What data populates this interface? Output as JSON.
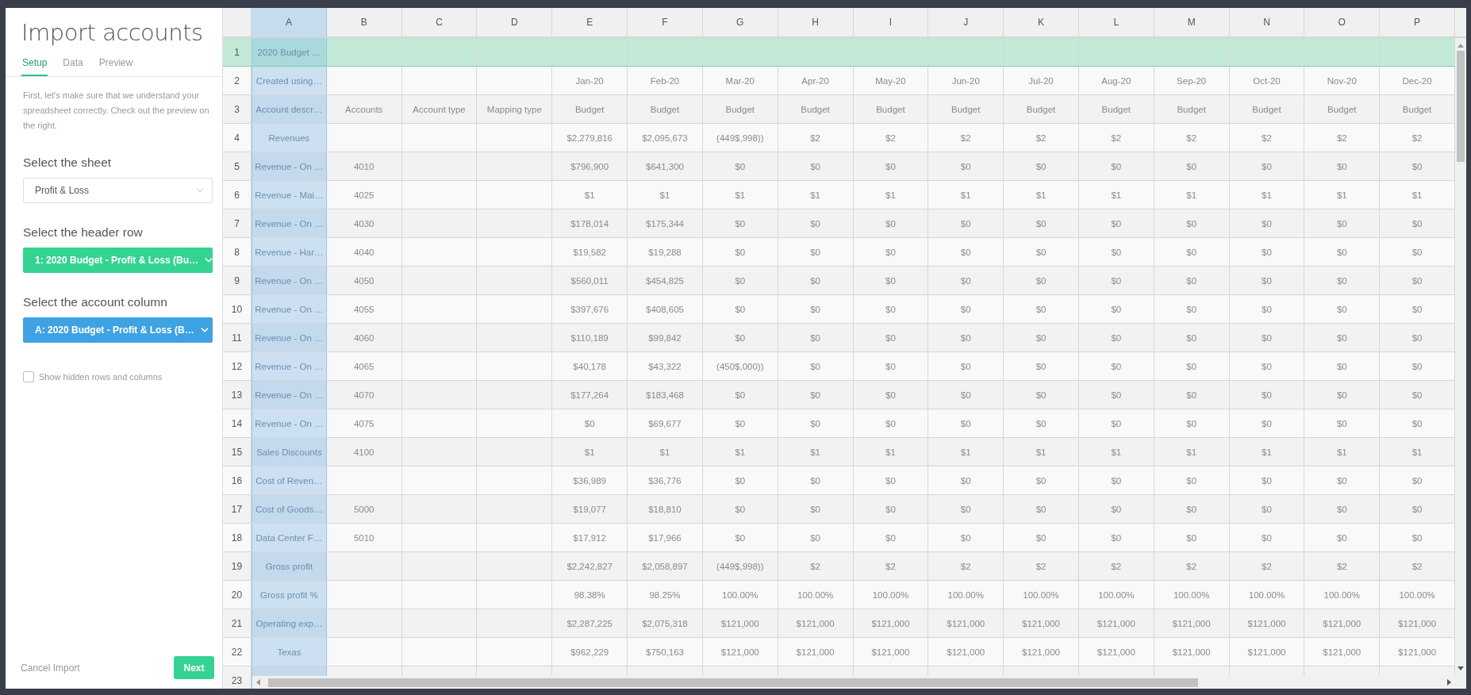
{
  "panel": {
    "title": "Import accounts",
    "tabs": [
      {
        "label": "Setup",
        "selected": true
      },
      {
        "label": "Data",
        "selected": false
      },
      {
        "label": "Preview",
        "selected": false
      }
    ],
    "intro": "First, let's make sure that we understand your spreadsheet correctly. Check out the preview on the right.",
    "selects": [
      {
        "label": "Select the sheet",
        "value": "Profit & Loss",
        "kind": "plain"
      },
      {
        "label": "Select the header row",
        "value": "1: 2020 Budget - Profit & Loss (Bu…",
        "kind": "header"
      },
      {
        "label": "Select the account column",
        "value": "A: 2020 Budget - Profit & Loss (B…",
        "kind": "column"
      }
    ],
    "checkbox": {
      "label": "Show hidden rows and columns",
      "checked": false
    },
    "cancel": "Cancel Import",
    "next": "Next"
  },
  "sheet": {
    "columns": [
      {
        "label": "A",
        "selected": true
      },
      {
        "label": "B",
        "selected": false
      },
      {
        "label": "C",
        "selected": false
      },
      {
        "label": "D",
        "selected": false
      },
      {
        "label": "E",
        "selected": false
      },
      {
        "label": "F",
        "selected": false
      },
      {
        "label": "G",
        "selected": false
      },
      {
        "label": "H",
        "selected": false
      },
      {
        "label": "I",
        "selected": false
      },
      {
        "label": "J",
        "selected": false
      },
      {
        "label": "K",
        "selected": false
      },
      {
        "label": "L",
        "selected": false
      },
      {
        "label": "M",
        "selected": false
      },
      {
        "label": "N",
        "selected": false
      },
      {
        "label": "O",
        "selected": false
      },
      {
        "label": "P",
        "selected": false
      }
    ],
    "rows": [
      {
        "number": "1",
        "selected": true,
        "cells": [
          "2020 Budget …",
          null,
          null,
          null,
          null,
          null,
          null,
          null,
          null,
          null,
          null,
          null,
          null,
          null,
          null,
          null
        ]
      },
      {
        "number": "2",
        "selected": false,
        "cells": [
          "Created using…",
          null,
          null,
          null,
          "Jan-20",
          "Feb-20",
          "Mar-20",
          "Apr-20",
          "May-20",
          "Jun-20",
          "Jul-20",
          "Aug-20",
          "Sep-20",
          "Oct-20",
          "Nov-20",
          "Dec-20"
        ]
      },
      {
        "number": "3",
        "selected": false,
        "cells": [
          "Account descr…",
          "Accounts",
          "Account type",
          "Mapping type",
          "Budget",
          "Budget",
          "Budget",
          "Budget",
          "Budget",
          "Budget",
          "Budget",
          "Budget",
          "Budget",
          "Budget",
          "Budget",
          "Budget"
        ]
      },
      {
        "number": "4",
        "selected": false,
        "cells": [
          "Revenues",
          null,
          null,
          null,
          "$2,279,816",
          "$2,095,673",
          "(449$,998))",
          "$2",
          "$2",
          "$2",
          "$2",
          "$2",
          "$2",
          "$2",
          "$2",
          "$2"
        ]
      },
      {
        "number": "5",
        "selected": false,
        "cells": [
          "Revenue - On …",
          "4010",
          null,
          null,
          "$796,900",
          "$641,300",
          "$0",
          "$0",
          "$0",
          "$0",
          "$0",
          "$0",
          "$0",
          "$0",
          "$0",
          "$0"
        ]
      },
      {
        "number": "6",
        "selected": false,
        "cells": [
          "Revenue - Mai…",
          "4025",
          null,
          null,
          "$1",
          "$1",
          "$1",
          "$1",
          "$1",
          "$1",
          "$1",
          "$1",
          "$1",
          "$1",
          "$1",
          "$1"
        ]
      },
      {
        "number": "7",
        "selected": false,
        "cells": [
          "Revenue - On …",
          "4030",
          null,
          null,
          "$178,014",
          "$175,344",
          "$0",
          "$0",
          "$0",
          "$0",
          "$0",
          "$0",
          "$0",
          "$0",
          "$0",
          "$0"
        ]
      },
      {
        "number": "8",
        "selected": false,
        "cells": [
          "Revenue - Har…",
          "4040",
          null,
          null,
          "$19,582",
          "$19,288",
          "$0",
          "$0",
          "$0",
          "$0",
          "$0",
          "$0",
          "$0",
          "$0",
          "$0",
          "$0"
        ]
      },
      {
        "number": "9",
        "selected": false,
        "cells": [
          "Revenue - On …",
          "4050",
          null,
          null,
          "$560,011",
          "$454,825",
          "$0",
          "$0",
          "$0",
          "$0",
          "$0",
          "$0",
          "$0",
          "$0",
          "$0",
          "$0"
        ]
      },
      {
        "number": "10",
        "selected": false,
        "cells": [
          "Revenue - On …",
          "4055",
          null,
          null,
          "$397,676",
          "$408,605",
          "$0",
          "$0",
          "$0",
          "$0",
          "$0",
          "$0",
          "$0",
          "$0",
          "$0",
          "$0"
        ]
      },
      {
        "number": "11",
        "selected": false,
        "cells": [
          "Revenue - On …",
          "4060",
          null,
          null,
          "$110,189",
          "$99,842",
          "$0",
          "$0",
          "$0",
          "$0",
          "$0",
          "$0",
          "$0",
          "$0",
          "$0",
          "$0"
        ]
      },
      {
        "number": "12",
        "selected": false,
        "cells": [
          "Revenue - On …",
          "4065",
          null,
          null,
          "$40,178",
          "$43,322",
          "(450$,000))",
          "$0",
          "$0",
          "$0",
          "$0",
          "$0",
          "$0",
          "$0",
          "$0",
          "$0"
        ]
      },
      {
        "number": "13",
        "selected": false,
        "cells": [
          "Revenue - On …",
          "4070",
          null,
          null,
          "$177,264",
          "$183,468",
          "$0",
          "$0",
          "$0",
          "$0",
          "$0",
          "$0",
          "$0",
          "$0",
          "$0",
          "$0"
        ]
      },
      {
        "number": "14",
        "selected": false,
        "cells": [
          "Revenue - On …",
          "4075",
          null,
          null,
          "$0",
          "$69,677",
          "$0",
          "$0",
          "$0",
          "$0",
          "$0",
          "$0",
          "$0",
          "$0",
          "$0",
          "$0"
        ]
      },
      {
        "number": "15",
        "selected": false,
        "cells": [
          "Sales Discounts",
          "4100",
          null,
          null,
          "$1",
          "$1",
          "$1",
          "$1",
          "$1",
          "$1",
          "$1",
          "$1",
          "$1",
          "$1",
          "$1",
          "$1"
        ]
      },
      {
        "number": "16",
        "selected": false,
        "cells": [
          "Cost of Reven…",
          null,
          null,
          null,
          "$36,989",
          "$36,776",
          "$0",
          "$0",
          "$0",
          "$0",
          "$0",
          "$0",
          "$0",
          "$0",
          "$0",
          "$0"
        ]
      },
      {
        "number": "17",
        "selected": false,
        "cells": [
          "Cost of Goods…",
          "5000",
          null,
          null,
          "$19,077",
          "$18,810",
          "$0",
          "$0",
          "$0",
          "$0",
          "$0",
          "$0",
          "$0",
          "$0",
          "$0",
          "$0"
        ]
      },
      {
        "number": "18",
        "selected": false,
        "cells": [
          "Data Center F…",
          "5010",
          null,
          null,
          "$17,912",
          "$17,966",
          "$0",
          "$0",
          "$0",
          "$0",
          "$0",
          "$0",
          "$0",
          "$0",
          "$0",
          "$0"
        ]
      },
      {
        "number": "19",
        "selected": false,
        "cells": [
          "Gross profit",
          null,
          null,
          null,
          "$2,242,827",
          "$2,058,897",
          "(449$,998))",
          "$2",
          "$2",
          "$2",
          "$2",
          "$2",
          "$2",
          "$2",
          "$2",
          "$2"
        ]
      },
      {
        "number": "20",
        "selected": false,
        "cells": [
          "Gross profit %",
          null,
          null,
          null,
          "98.38%",
          "98.25%",
          "100.00%",
          "100.00%",
          "100.00%",
          "100.00%",
          "100.00%",
          "100.00%",
          "100.00%",
          "100.00%",
          "100.00%",
          "100.00%"
        ]
      },
      {
        "number": "21",
        "selected": false,
        "cells": [
          "Operating exp…",
          null,
          null,
          null,
          "$2,287,225",
          "$2,075,318",
          "$121,000",
          "$121,000",
          "$121,000",
          "$121,000",
          "$121,000",
          "$121,000",
          "$121,000",
          "$121,000",
          "$121,000",
          "$121,000"
        ]
      },
      {
        "number": "22",
        "selected": false,
        "cells": [
          "Texas",
          null,
          null,
          null,
          "$962,229",
          "$750,163",
          "$121,000",
          "$121,000",
          "$121,000",
          "$121,000",
          "$121,000",
          "$121,000",
          "$121,000",
          "$121,000",
          "$121,000",
          "$121,000"
        ]
      },
      {
        "number": "23",
        "selected": false,
        "cells": [
          null,
          null,
          null,
          null,
          null,
          null,
          null,
          null,
          null,
          null,
          null,
          null,
          null,
          null,
          null,
          null
        ]
      }
    ]
  }
}
